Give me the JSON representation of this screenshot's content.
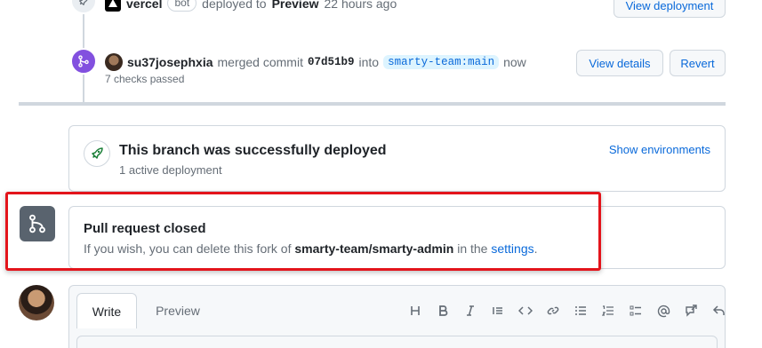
{
  "timeline": {
    "deploy_event": {
      "actor": "vercel",
      "bot_tag": "bot",
      "action": "deployed to",
      "environment": "Preview",
      "time": "22 hours ago",
      "button": "View deployment"
    },
    "merge_event": {
      "actor": "su37josephxia",
      "action": "merged commit",
      "commit": "07d51b9",
      "into": "into",
      "branch_owner": "smarty-team",
      "branch_sep": ":",
      "branch_name": "main",
      "time": "now",
      "checks": "7 checks passed",
      "view_details": "View details",
      "revert": "Revert"
    }
  },
  "deploy_status": {
    "title": "This branch was successfully deployed",
    "subtitle": "1 active deployment",
    "link": "Show environments"
  },
  "closed_status": {
    "title": "Pull request closed",
    "text_before": "If you wish, you can delete this fork of",
    "repo": "smarty-team/smarty-admin",
    "text_middle": "in the",
    "link": "settings",
    "text_after": "."
  },
  "comment_editor": {
    "tabs": [
      "Write",
      "Preview"
    ],
    "toolbar": [
      "heading-icon",
      "bold-icon",
      "italic-icon",
      "quote-icon",
      "code-icon",
      "link-icon",
      "bulleted-list-icon",
      "numbered-list-icon",
      "task-list-icon",
      "mention-icon",
      "cross-reference-icon",
      "reply-icon"
    ]
  },
  "colors": {
    "accent": "#0969da",
    "merged": "#8250df",
    "closed_badge": "#59636e",
    "highlight": "#e3141b"
  }
}
